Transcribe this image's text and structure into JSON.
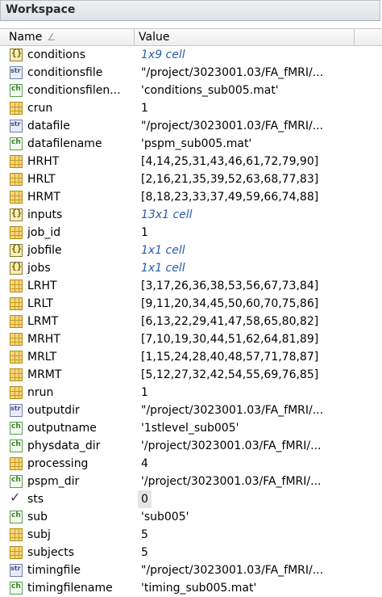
{
  "panel": {
    "title": "Workspace"
  },
  "columns": {
    "name": "Name",
    "name_sort": "∠",
    "value": "Value"
  },
  "rows": [
    {
      "icon": "cell",
      "name": "conditions",
      "value": "1x9 cell",
      "kind": "cell"
    },
    {
      "icon": "str",
      "name": "conditionsfile",
      "value": "\"/project/3023001.03/FA_fMRI/...",
      "kind": "plain"
    },
    {
      "icon": "char",
      "name": "conditionsfilen...",
      "value": "'conditions_sub005.mat'",
      "kind": "plain"
    },
    {
      "icon": "num",
      "name": "crun",
      "value": "1",
      "kind": "plain"
    },
    {
      "icon": "str",
      "name": "datafile",
      "value": "\"/project/3023001.03/FA_fMRI/...",
      "kind": "plain"
    },
    {
      "icon": "char",
      "name": "datafilename",
      "value": "'pspm_sub005.mat'",
      "kind": "plain"
    },
    {
      "icon": "num",
      "name": "HRHT",
      "value": "[4,14,25,31,43,46,61,72,79,90]",
      "kind": "plain"
    },
    {
      "icon": "num",
      "name": "HRLT",
      "value": "[2,16,21,35,39,52,63,68,77,83]",
      "kind": "plain"
    },
    {
      "icon": "num",
      "name": "HRMT",
      "value": "[8,18,23,33,37,49,59,66,74,88]",
      "kind": "plain"
    },
    {
      "icon": "cell",
      "name": "inputs",
      "value": "13x1 cell",
      "kind": "cell"
    },
    {
      "icon": "num",
      "name": "job_id",
      "value": "1",
      "kind": "plain"
    },
    {
      "icon": "cell",
      "name": "jobfile",
      "value": "1x1 cell",
      "kind": "cell"
    },
    {
      "icon": "cell",
      "name": "jobs",
      "value": "1x1 cell",
      "kind": "cell"
    },
    {
      "icon": "num",
      "name": "LRHT",
      "value": "[3,17,26,36,38,53,56,67,73,84]",
      "kind": "plain"
    },
    {
      "icon": "num",
      "name": "LRLT",
      "value": "[9,11,20,34,45,50,60,70,75,86]",
      "kind": "plain"
    },
    {
      "icon": "num",
      "name": "LRMT",
      "value": "[6,13,22,29,41,47,58,65,80,82]",
      "kind": "plain"
    },
    {
      "icon": "num",
      "name": "MRHT",
      "value": "[7,10,19,30,44,51,62,64,81,89]",
      "kind": "plain"
    },
    {
      "icon": "num",
      "name": "MRLT",
      "value": "[1,15,24,28,40,48,57,71,78,87]",
      "kind": "plain"
    },
    {
      "icon": "num",
      "name": "MRMT",
      "value": "[5,12,27,32,42,54,55,69,76,85]",
      "kind": "plain"
    },
    {
      "icon": "num",
      "name": "nrun",
      "value": "1",
      "kind": "plain"
    },
    {
      "icon": "str",
      "name": "outputdir",
      "value": "\"/project/3023001.03/FA_fMRI/...",
      "kind": "plain"
    },
    {
      "icon": "char",
      "name": "outputname",
      "value": "'1stlevel_sub005'",
      "kind": "plain"
    },
    {
      "icon": "char",
      "name": "physdata_dir",
      "value": "'/project/3023001.03/FA_fMRI/...",
      "kind": "plain"
    },
    {
      "icon": "num",
      "name": "processing",
      "value": "4",
      "kind": "plain"
    },
    {
      "icon": "char",
      "name": "pspm_dir",
      "value": "'/project/3023001.03/FA_fMRI/...",
      "kind": "plain"
    },
    {
      "icon": "logical",
      "name": "sts",
      "value": "0",
      "kind": "selected"
    },
    {
      "icon": "char",
      "name": "sub",
      "value": "'sub005'",
      "kind": "plain"
    },
    {
      "icon": "num",
      "name": "subj",
      "value": "5",
      "kind": "plain"
    },
    {
      "icon": "num",
      "name": "subjects",
      "value": "5",
      "kind": "plain"
    },
    {
      "icon": "str",
      "name": "timingfile",
      "value": "\"/project/3023001.03/FA_fMRI/...",
      "kind": "plain"
    },
    {
      "icon": "char",
      "name": "timingfilename",
      "value": "'timing_sub005.mat'",
      "kind": "plain"
    }
  ]
}
